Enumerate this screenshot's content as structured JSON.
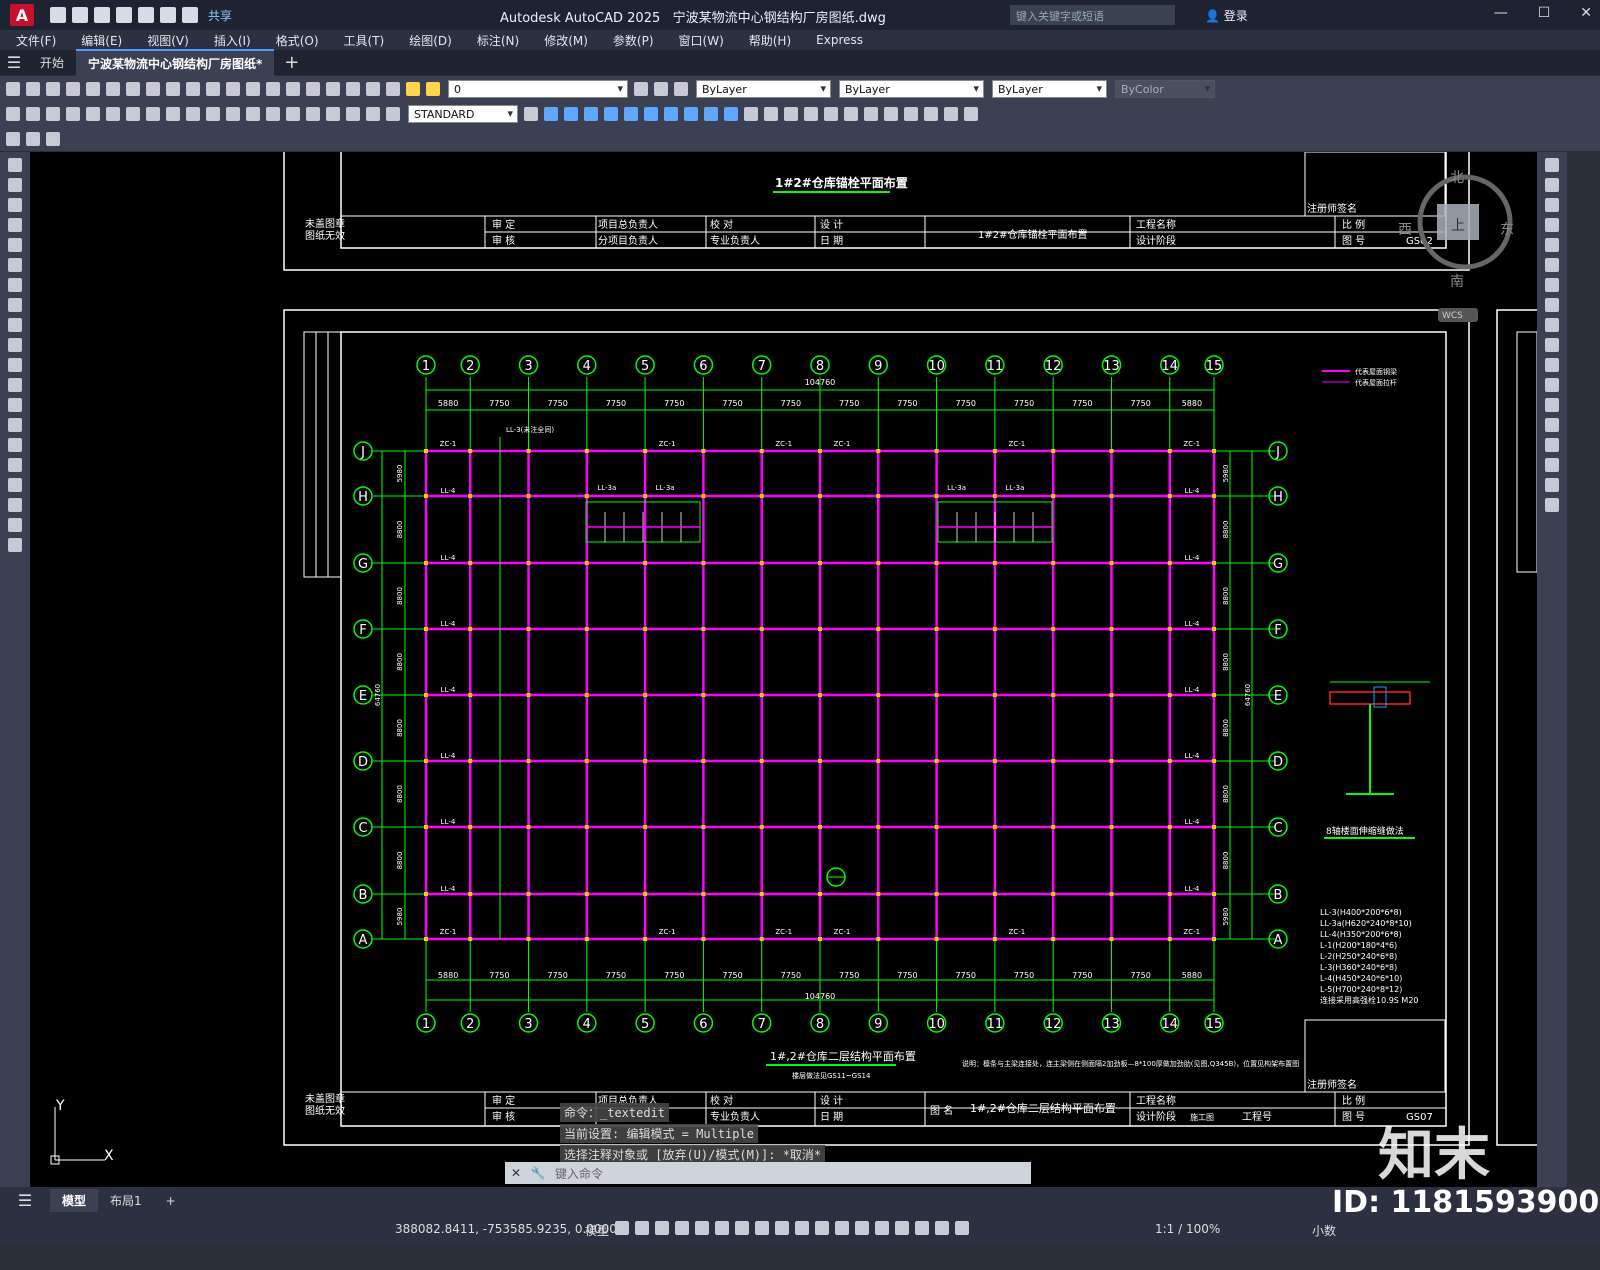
{
  "window": {
    "app_title": "Autodesk AutoCAD 2025",
    "doc_title": "宁波某物流中心钢结构厂房图纸.dwg",
    "search_placeholder": "键入关键字或短语",
    "login": "登录",
    "share": "共享"
  },
  "menus": [
    "文件(F)",
    "编辑(E)",
    "视图(V)",
    "插入(I)",
    "格式(O)",
    "工具(T)",
    "绘图(D)",
    "标注(N)",
    "修改(M)",
    "参数(P)",
    "窗口(W)",
    "帮助(H)",
    "Express"
  ],
  "tabs": {
    "start": "开始",
    "active": "宁波某物流中心钢结构厂房图纸*"
  },
  "toolbar": {
    "layer_value": "0",
    "color": "ByLayer",
    "linetype": "ByLayer",
    "lineweight": "ByLayer",
    "plotstyle": "ByColor",
    "text_style": "STANDARD"
  },
  "viewcube": {
    "north": "北",
    "south": "南",
    "east": "东",
    "west": "西",
    "top": "上",
    "wcs": "WCS"
  },
  "drawing": {
    "axis_numbers": [
      "1",
      "2",
      "3",
      "4",
      "5",
      "6",
      "7",
      "8",
      "9",
      "10",
      "11",
      "12",
      "13",
      "14",
      "15"
    ],
    "axis_letters": [
      "J",
      "H",
      "G",
      "F",
      "E",
      "D",
      "C",
      "B",
      "A"
    ],
    "spans": [
      "5880",
      "7750",
      "7750",
      "7750",
      "7750",
      "7750",
      "7750",
      "7750",
      "7750",
      "7750",
      "7750",
      "7750",
      "7750",
      "5880"
    ],
    "total_length": "104760",
    "total_width": "64760",
    "row_spans_left": [
      "5980",
      "8800",
      "8800",
      "8800",
      "8800",
      "8800",
      "8800",
      "5980"
    ],
    "top_title": "1#2#仓库锚栓平面布置",
    "main_title": "1#,2#仓库二层结构平面布置",
    "main_subtitle": "楼层做法见GS11~GS14",
    "note": "说明：檩条与主梁连接处，连主梁侧在侧面隔2加劲板—8*100厚做加劲肋(见图,Q345B)，位置见构架布置图",
    "detail_title": "8轴楼面伸缩缝做法",
    "legend": [
      "代表屋面钢梁",
      "代表屋面拉杆"
    ],
    "member_list": [
      "LL-3(H400*200*6*8)",
      "LL-3a(H620*240*8*10)",
      "LL-4(H350*200*6*8)",
      "L-1(H200*180*4*6)",
      "L-2(H250*240*6*8)",
      "L-3(H360*240*6*8)",
      "L-4(H450*240*6*10)",
      "L-5(H700*240*8*12)",
      "连接采用高强栓10.9S M20"
    ],
    "labels": {
      "zc": "ZC-1",
      "ll4": "LL-4",
      "ll3a": "LL-3a",
      "ll_unblock": "LL-3(未注全同)"
    },
    "title_block": {
      "unsigned": "未盖图章",
      "invalid": "图纸无效",
      "approve": "审 定",
      "review": "审 核",
      "proj_lead": "项目总负责人",
      "sub_lead": "分项目负责人",
      "check": "校 对",
      "specialty": "专业负责人",
      "design": "设 计",
      "date": "日 期",
      "drawing_name": "图 名",
      "project_name": "工程名称",
      "design_stage": "设计阶段",
      "stage_value": "施工图",
      "project_no": "工程号",
      "scale": "比 例",
      "sheet_no": "图 号",
      "reg_stamp": "注册师签名",
      "top_sheet": "GS02",
      "main_sheet": "GS07"
    }
  },
  "command": {
    "history": [
      "命令：_textedit",
      "当前设置: 编辑模式 = Multiple",
      "选择注释对象或 [放弃(U)/模式(M)]: *取消*"
    ],
    "placeholder": "键入命令"
  },
  "layouts": {
    "model": "模型",
    "layout1": "布局1"
  },
  "status": {
    "coords": "388082.8411, -753585.9235, 0.0000",
    "mode": "模型",
    "scale": "1:1 / 100%",
    "units": "小数"
  },
  "watermark": {
    "brand": "知末",
    "id": "ID: 1181593900"
  },
  "colors": {
    "grid": "#00ff00",
    "beam": "#ff00ff",
    "frame": "#ffffff",
    "accent": "#4aa0ff"
  }
}
